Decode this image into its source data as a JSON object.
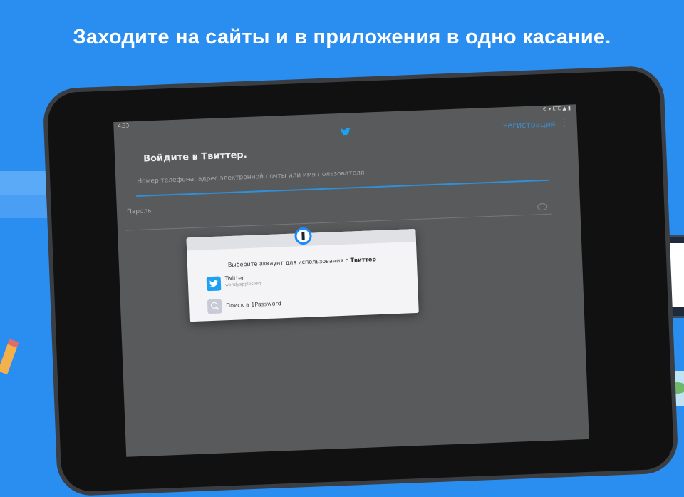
{
  "headline": "Заходите на сайты и в приложения в одно касание.",
  "status": {
    "time": "4:33",
    "icons": "⊙ ▾ LTE ▲ ▮"
  },
  "appbar": {
    "logo_icon": "twitter-bird-icon",
    "signup": "Регистрация"
  },
  "login": {
    "title": "Войдите в Твиттер.",
    "username_placeholder": "Номер телефона, адрес электронной почты или имя пользователя",
    "password_placeholder": "Пароль"
  },
  "dialog": {
    "prompt": "Выберите аккаунт для использования с ",
    "prompt_app": "Твиттер",
    "accounts": [
      {
        "name": "Twitter",
        "username": "wendyappleseed"
      }
    ],
    "search_label": "Поиск в 1Password"
  },
  "colors": {
    "background": "#2a8ef0",
    "accent": "#1a8cff",
    "twitter": "#1da1f2"
  }
}
